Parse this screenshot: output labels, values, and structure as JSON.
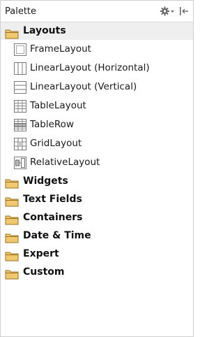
{
  "panel": {
    "title": "Palette",
    "gear_icon": "gear-dropdown-icon",
    "pin_icon": "hide-panel-icon"
  },
  "colors": {
    "folder_fill": "#f0c870",
    "folder_stroke": "#9a7020",
    "open_row_bg": "#efefef",
    "icon_stroke": "#7a7a7a"
  },
  "groups": [
    {
      "label": "Layouts",
      "expanded": true,
      "items": [
        {
          "label": "FrameLayout",
          "icon": "frame-layout-icon"
        },
        {
          "label": "LinearLayout (Horizontal)",
          "icon": "linear-layout-horizontal-icon"
        },
        {
          "label": "LinearLayout (Vertical)",
          "icon": "linear-layout-vertical-icon"
        },
        {
          "label": "TableLayout",
          "icon": "table-layout-icon"
        },
        {
          "label": "TableRow",
          "icon": "table-row-icon"
        },
        {
          "label": "GridLayout",
          "icon": "grid-layout-icon"
        },
        {
          "label": "RelativeLayout",
          "icon": "relative-layout-icon"
        }
      ]
    },
    {
      "label": "Widgets",
      "expanded": false
    },
    {
      "label": "Text Fields",
      "expanded": false
    },
    {
      "label": "Containers",
      "expanded": false
    },
    {
      "label": "Date & Time",
      "expanded": false
    },
    {
      "label": "Expert",
      "expanded": false
    },
    {
      "label": "Custom",
      "expanded": false
    }
  ]
}
